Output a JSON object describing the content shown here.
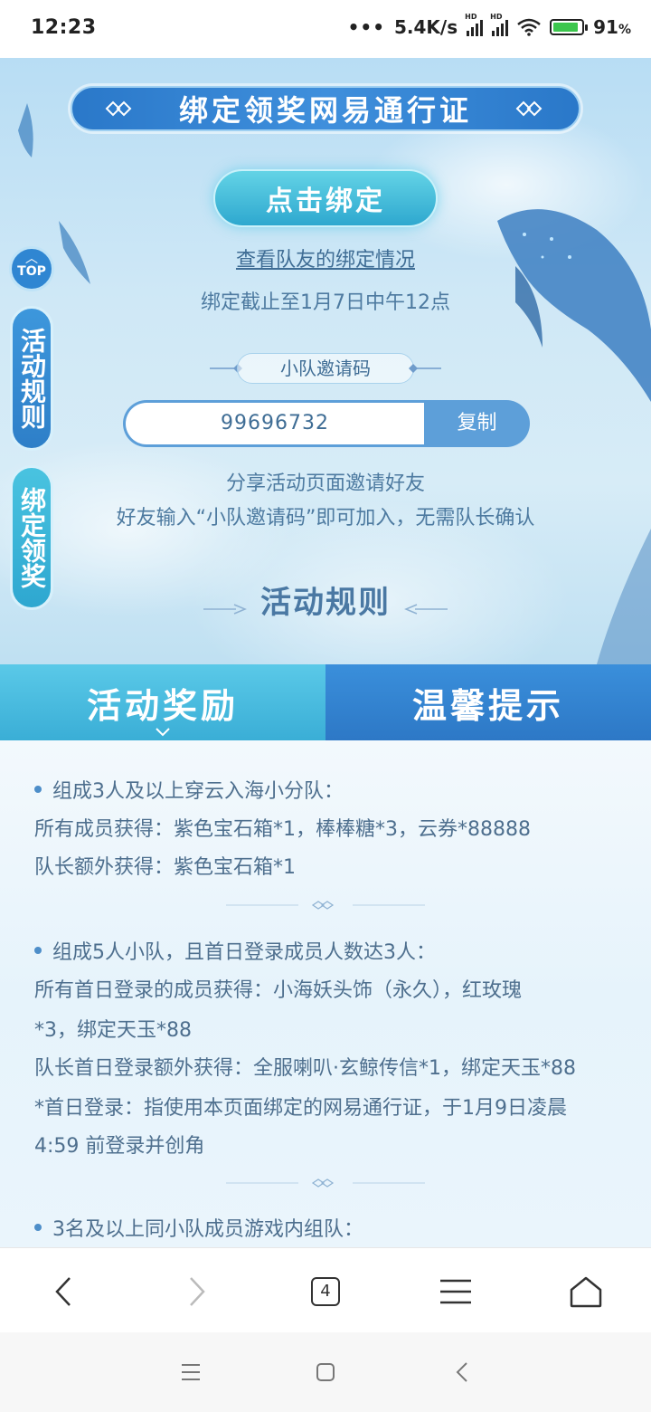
{
  "status_bar": {
    "time": "12:23",
    "network_speed": "5.4K/s",
    "battery_percent": "91",
    "battery_unit": "%",
    "signal_label": "HD"
  },
  "hero": {
    "title": "绑定领奖网易通行证",
    "bind_button_label": "点击绑定",
    "view_teammates_link": "查看队友的绑定情况",
    "deadline_text": "绑定截止至1月7日中午12点",
    "invite_label": "小队邀请码",
    "invite_code": "99696732",
    "copy_label": "复制",
    "share_line1": "分享活动页面邀请好友",
    "share_line2": "好友输入“小队邀请码”即可加入，无需队长确认",
    "rules_heading": "活动规则"
  },
  "side_nav": {
    "top_label": "TOP",
    "rules_label": "活动规则",
    "bind_label": "绑定领奖"
  },
  "tabs": [
    {
      "label": "活动奖励",
      "active": true
    },
    {
      "label": "温馨提示",
      "active": false
    }
  ],
  "rewards": {
    "section1": {
      "heading": "组成3人及以上穿云入海小分队：",
      "line1": "所有成员获得：紫色宝石箱*1，棒棒糖*3，云券*88888",
      "line2": "队长额外获得：紫色宝石箱*1"
    },
    "section2": {
      "heading": "组成5人小队，且首日登录成员人数达3人：",
      "line1": "所有首日登录的成员获得：小海妖头饰（永久），红玫瑰",
      "line2": "*3，绑定天玉*88",
      "line3": "队长首日登录额外获得：全服喇叭·玄鲸传信*1，绑定天玉*88",
      "line4": "*首日登录：指使用本页面绑定的网易通行证，于1月9日凌晨",
      "line5": "4:59 前登录并创角"
    },
    "section3": {
      "heading": "3名及以上同小队成员游戏内组队："
    }
  },
  "browser_bar": {
    "tab_count": "4"
  },
  "colors": {
    "primary_blue": "#2f86d2",
    "cyan_accent": "#3aaed6",
    "text_blue": "#4e6f8e"
  }
}
